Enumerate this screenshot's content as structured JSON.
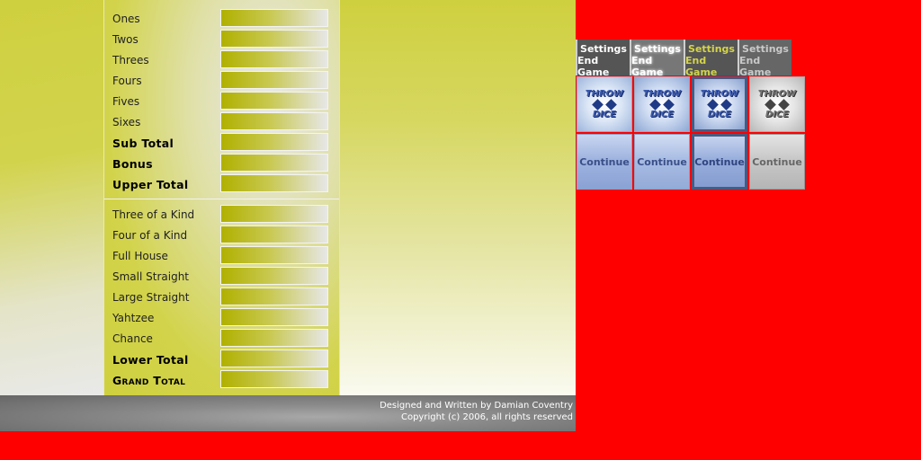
{
  "scorecard": {
    "upper": [
      {
        "label": "Ones",
        "value": ""
      },
      {
        "label": "Twos",
        "value": ""
      },
      {
        "label": "Threes",
        "value": ""
      },
      {
        "label": "Fours",
        "value": ""
      },
      {
        "label": "Fives",
        "value": ""
      },
      {
        "label": "Sixes",
        "value": ""
      },
      {
        "label": "Sub Total",
        "value": ""
      },
      {
        "label": "Bonus",
        "value": ""
      },
      {
        "label": "Upper Total",
        "value": ""
      }
    ],
    "lower": [
      {
        "label": "Three of a Kind",
        "value": ""
      },
      {
        "label": "Four of a Kind",
        "value": ""
      },
      {
        "label": "Full House",
        "value": ""
      },
      {
        "label": "Small Straight",
        "value": ""
      },
      {
        "label": "Large Straight",
        "value": ""
      },
      {
        "label": "Yahtzee",
        "value": ""
      },
      {
        "label": "Chance",
        "value": ""
      },
      {
        "label": "Lower Total",
        "value": ""
      },
      {
        "label": "Grand Total",
        "value": ""
      }
    ]
  },
  "footer": {
    "credit": "Designed and Written by Damian Coventry",
    "copyright": "Copyright (c) 2006, all rights reserved"
  },
  "settings_buttons": [
    "Settings",
    "Settings",
    "Settings",
    "Settings"
  ],
  "endgame_buttons": [
    "End Game",
    "End Game",
    "End Game",
    "End Game"
  ],
  "throw_dice_tiles": [
    {
      "line1": "THROW",
      "line2": "DICE"
    },
    {
      "line1": "THROW",
      "line2": "DICE"
    },
    {
      "line1": "THROW",
      "line2": "DICE"
    },
    {
      "line1": "THROW",
      "line2": "DICE"
    }
  ],
  "continue_buttons": [
    "Continue",
    "Continue",
    "Continue",
    "Continue"
  ],
  "colors": {
    "page_bg": "#ff0000",
    "panel_yellow": "#cfd03f",
    "field_dark": "#b0b000",
    "footer_grey": "#8a8a8a",
    "dice_blue": "#3c5bb0"
  },
  "icons": [
    "dice-icon"
  ]
}
